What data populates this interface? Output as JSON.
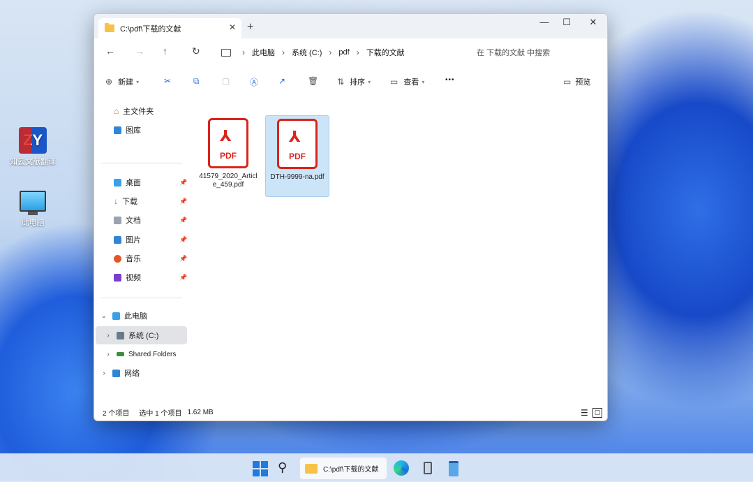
{
  "desktop": {
    "icons": [
      {
        "label": "知云文献翻译",
        "logo": "ZY"
      },
      {
        "label": "此电脑"
      }
    ]
  },
  "window": {
    "tab_title": "C:\\pdf\\下载的文献",
    "new_tab": "+",
    "tab_close": "✕",
    "controls": {
      "minimize": "—",
      "maximize": "☐",
      "close": "✕"
    },
    "nav": {
      "back": "←",
      "forward": "→",
      "up": "↑",
      "refresh": "↻"
    },
    "breadcrumb": [
      "此电脑",
      "系统 (C:)",
      "pdf",
      "下载的文献"
    ],
    "search_placeholder": "在 下载的文献 中搜索",
    "toolbar": {
      "new_label": "新建",
      "sort_label": "排序",
      "view_label": "查看",
      "more": "•••",
      "preview_label": "预览"
    },
    "sidebar": {
      "top": [
        {
          "label": "主文件夹"
        },
        {
          "label": "图库"
        }
      ],
      "quick_access": [
        {
          "label": "桌面"
        },
        {
          "label": "下载"
        },
        {
          "label": "文档"
        },
        {
          "label": "图片"
        },
        {
          "label": "音乐"
        },
        {
          "label": "视频"
        }
      ],
      "this_pc": "此电脑",
      "drives": [
        {
          "label": "系统 (C:)"
        },
        {
          "label": "Shared Folders"
        }
      ],
      "network": "网络"
    },
    "files": [
      {
        "name": "41579_2020_Article_459.pdf",
        "selected": false
      },
      {
        "name": "DTH-9999-na.pdf",
        "selected": true
      }
    ],
    "file_icon_text": "PDF",
    "status": {
      "count": "2 个项目",
      "selected": "选中 1 个项目",
      "size": "1.62 MB"
    }
  },
  "taskbar": {
    "active_app_label": "C:\\pdf\\下载的文献"
  },
  "colors": {
    "accent": "#2a6fd6",
    "pdf_red": "#d9241c",
    "selection": "#cce4f7",
    "folder": "#f6c34a"
  }
}
